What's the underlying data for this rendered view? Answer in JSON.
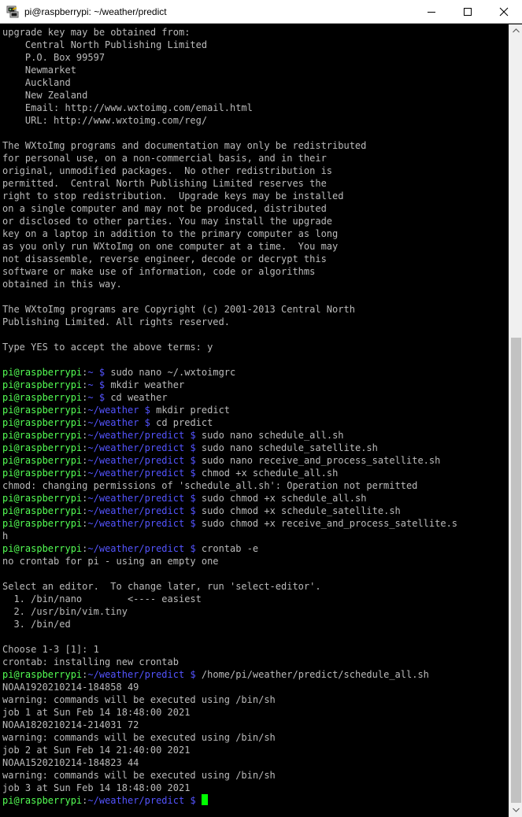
{
  "window": {
    "title": "pi@raspberrypi: ~/weather/predict",
    "icon": "putty-terminal-icon"
  },
  "controls": {
    "minimize": "minimize-icon",
    "maximize": "maximize-icon",
    "close": "close-icon"
  },
  "terminal": {
    "lines": [
      {
        "text": "upgrade key may be obtained from:"
      },
      {
        "text": "    Central North Publishing Limited"
      },
      {
        "text": "    P.O. Box 99597"
      },
      {
        "text": "    Newmarket"
      },
      {
        "text": "    Auckland"
      },
      {
        "text": "    New Zealand"
      },
      {
        "text": "    Email: http://www.wxtoimg.com/email.html"
      },
      {
        "text": "    URL: http://www.wxtoimg.com/reg/"
      },
      {
        "text": ""
      },
      {
        "text": "The WXtoImg programs and documentation may only be redistributed"
      },
      {
        "text": "for personal use, on a non-commercial basis, and in their"
      },
      {
        "text": "original, unmodified packages.  No other redistribution is"
      },
      {
        "text": "permitted.  Central North Publishing Limited reserves the"
      },
      {
        "text": "right to stop redistribution.  Upgrade keys may be installed"
      },
      {
        "text": "on a single computer and may not be produced, distributed"
      },
      {
        "text": "or disclosed to other parties. You may install the upgrade"
      },
      {
        "text": "key on a laptop in addition to the primary computer as long"
      },
      {
        "text": "as you only run WXtoImg on one computer at a time.  You may"
      },
      {
        "text": "not disassemble, reverse engineer, decode or decrypt this"
      },
      {
        "text": "software or make use of information, code or algorithms"
      },
      {
        "text": "obtained in this way."
      },
      {
        "text": ""
      },
      {
        "text": "The WXtoImg programs are Copyright (c) 2001-2013 Central North"
      },
      {
        "text": "Publishing Limited. All rights reserved."
      },
      {
        "text": ""
      },
      {
        "text": "Type YES to accept the above terms: y"
      },
      {
        "text": ""
      },
      {
        "host": "pi@raspberrypi",
        "path": "~",
        "cmd": "sudo nano ~/.wxtoimgrc"
      },
      {
        "host": "pi@raspberrypi",
        "path": "~",
        "cmd": "mkdir weather"
      },
      {
        "host": "pi@raspberrypi",
        "path": "~",
        "cmd": "cd weather"
      },
      {
        "host": "pi@raspberrypi",
        "path": "~/weather",
        "cmd": "mkdir predict"
      },
      {
        "host": "pi@raspberrypi",
        "path": "~/weather",
        "cmd": "cd predict"
      },
      {
        "host": "pi@raspberrypi",
        "path": "~/weather/predict",
        "cmd": "sudo nano schedule_all.sh"
      },
      {
        "host": "pi@raspberrypi",
        "path": "~/weather/predict",
        "cmd": "sudo nano schedule_satellite.sh"
      },
      {
        "host": "pi@raspberrypi",
        "path": "~/weather/predict",
        "cmd": "sudo nano receive_and_process_satellite.sh"
      },
      {
        "host": "pi@raspberrypi",
        "path": "~/weather/predict",
        "cmd": "chmod +x schedule_all.sh"
      },
      {
        "text": "chmod: changing permissions of 'schedule_all.sh': Operation not permitted"
      },
      {
        "host": "pi@raspberrypi",
        "path": "~/weather/predict",
        "cmd": "sudo chmod +x schedule_all.sh"
      },
      {
        "host": "pi@raspberrypi",
        "path": "~/weather/predict",
        "cmd": "sudo chmod +x schedule_satellite.sh"
      },
      {
        "host": "pi@raspberrypi",
        "path": "~/weather/predict",
        "cmd": "sudo chmod +x receive_and_process_satellite.s"
      },
      {
        "text": "h"
      },
      {
        "host": "pi@raspberrypi",
        "path": "~/weather/predict",
        "cmd": "crontab -e"
      },
      {
        "text": "no crontab for pi - using an empty one"
      },
      {
        "text": ""
      },
      {
        "text": "Select an editor.  To change later, run 'select-editor'."
      },
      {
        "text": "  1. /bin/nano        <---- easiest"
      },
      {
        "text": "  2. /usr/bin/vim.tiny"
      },
      {
        "text": "  3. /bin/ed"
      },
      {
        "text": ""
      },
      {
        "text": "Choose 1-3 [1]: 1"
      },
      {
        "text": "crontab: installing new crontab"
      },
      {
        "host": "pi@raspberrypi",
        "path": "~/weather/predict",
        "cmd": "/home/pi/weather/predict/schedule_all.sh"
      },
      {
        "text": "NOAA1920210214-184858 49"
      },
      {
        "text": "warning: commands will be executed using /bin/sh"
      },
      {
        "text": "job 1 at Sun Feb 14 18:48:00 2021"
      },
      {
        "text": "NOAA1820210214-214031 72"
      },
      {
        "text": "warning: commands will be executed using /bin/sh"
      },
      {
        "text": "job 2 at Sun Feb 14 21:40:00 2021"
      },
      {
        "text": "NOAA1520210214-184823 44"
      },
      {
        "text": "warning: commands will be executed using /bin/sh"
      },
      {
        "text": "job 3 at Sun Feb 14 18:48:00 2021"
      },
      {
        "host": "pi@raspberrypi",
        "path": "~/weather/predict",
        "cmd": "",
        "cursor": true
      }
    ]
  },
  "colors": {
    "background": "#000000",
    "text": "#bbbbbb",
    "host": "#54ff54",
    "path": "#5454ff",
    "cursor": "#00ff00"
  },
  "scrollbar": {
    "up": "scroll-up-arrow-icon",
    "down": "scroll-down-arrow-icon"
  }
}
